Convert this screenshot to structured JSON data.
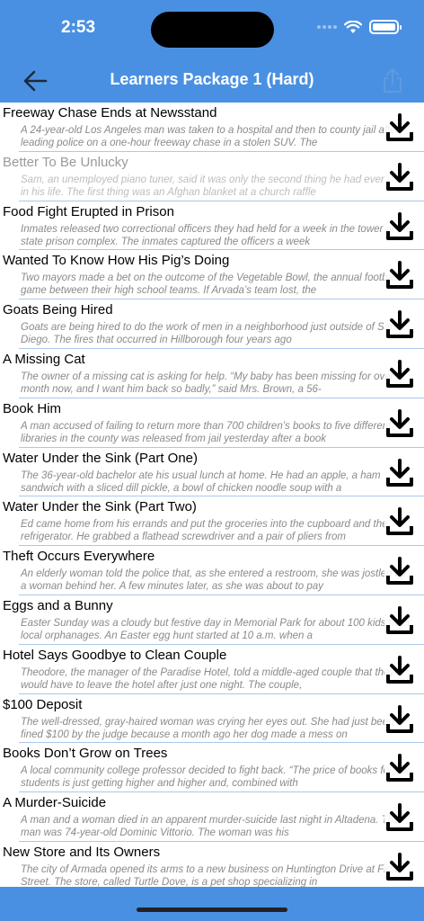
{
  "status_bar": {
    "time": "2:53"
  },
  "nav": {
    "title": "Learners Package 1 (Hard)",
    "back_icon": "arrow-left-icon",
    "share_icon": "share-icon"
  },
  "colors": {
    "header": "#4a90e2",
    "divider": "#a9c9ea",
    "title_text": "#000000",
    "description_text": "#8a8a8a"
  },
  "stories": [
    {
      "title": "Freeway Chase Ends at Newsstand",
      "description": "A 24-year-old Los Angeles man was taken to a hospital and then to county jail after leading police on a one-hour freeway chase in a stolen SUV. The",
      "disabled": false
    },
    {
      "title": "Better To Be Unlucky",
      "description": "Sam, an unemployed piano tuner, said it was only the second thing he had ever won in his life. The first thing was an Afghan blanket at a church raffle",
      "disabled": true
    },
    {
      "title": "Food Fight Erupted in Prison",
      "description": "Inmates released two correctional officers they had held for a week in the tower at the state prison complex. The inmates captured the officers a week",
      "disabled": false
    },
    {
      "title": "Wanted To Know How His Pig’s Doing",
      "description": "Two mayors made a bet on the outcome of the Vegetable Bowl, the annual football game between their high school teams. If Arvada’s team lost, the",
      "disabled": false
    },
    {
      "title": "Goats Being Hired",
      "description": "Goats are being hired to do the work of men in a neighborhood just outside of San Diego. The fires that occurred in Hillborough four years ago",
      "disabled": false
    },
    {
      "title": "A Missing Cat",
      "description": "The owner of a missing cat is asking for help. “My baby has been missing for over a month now, and I want him back so badly,” said Mrs. Brown, a 56-",
      "disabled": false
    },
    {
      "title": "Book Him",
      "description": "A man accused of failing to return more than 700 children’s books to five different libraries in the county was released from jail yesterday after a book",
      "disabled": false
    },
    {
      "title": "Water Under the Sink (Part One)",
      "description": "The 36-year-old bachelor ate his usual lunch at home. He had an apple, a ham sandwich with a sliced dill pickle, a bowl of chicken noodle soup with a",
      "disabled": false
    },
    {
      "title": "Water Under the Sink (Part Two)",
      "description": "Ed came home from his errands and put the groceries into the cupboard and the refrigerator. He grabbed a flathead screwdriver and a pair of pliers from",
      "disabled": false
    },
    {
      "title": "Theft Occurs Everywhere",
      "description": "An elderly woman told the police that, as she entered a restroom, she was jostled by a woman behind her. A few minutes later, as she was about to pay",
      "disabled": false
    },
    {
      "title": "Eggs and a Bunny",
      "description": "Easter Sunday was a cloudy but festive day in Memorial Park for about 100 kids from local orphanages. An Easter egg hunt started at 10 a.m. when a",
      "disabled": false
    },
    {
      "title": "Hotel Says Goodbye to Clean Couple",
      "description": "Theodore, the manager of the Paradise Hotel, told a middle-aged couple that they would have to leave the hotel after just one night. The couple,",
      "disabled": false
    },
    {
      "title": "$100 Deposit",
      "description": "The well-dressed, gray-haired woman was crying her eyes out. She had just been fined $100 by the judge because a month ago her dog made a mess on",
      "disabled": false
    },
    {
      "title": "Books Don’t Grow on Trees",
      "description": "A local community college professor decided to fight back. “The price of books for our students is just getting higher and higher and, combined with",
      "disabled": false
    },
    {
      "title": "A Murder-Suicide",
      "description": "A man and a woman died in an apparent murder-suicide last night in Altadena. The man was 74-year-old Dominic Vittorio. The woman was his",
      "disabled": false
    },
    {
      "title": "New Store and Its Owners",
      "description": "The city of Armada opened its arms to a new business on Huntington Drive at First Street. The store, called Turtle Dove, is a pet shop specializing in",
      "disabled": false
    }
  ],
  "download_icon": "download-icon"
}
